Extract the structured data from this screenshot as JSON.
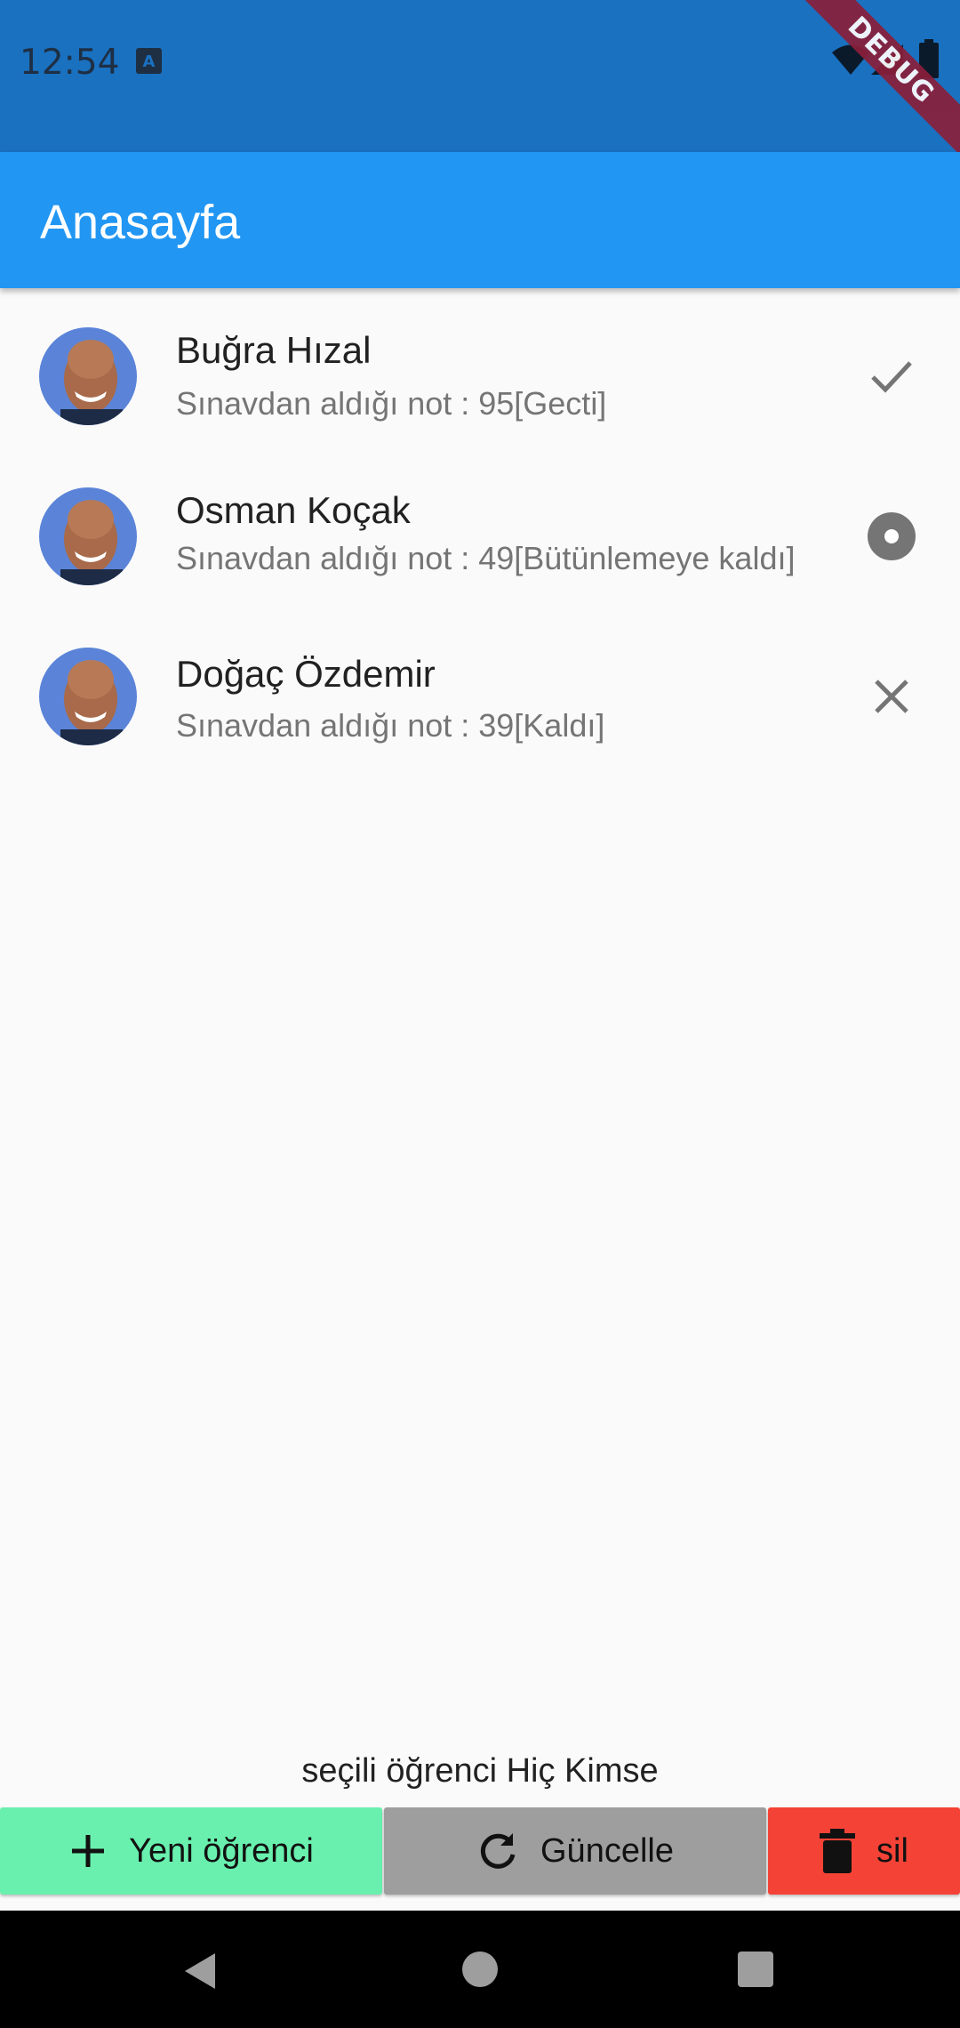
{
  "status_bar": {
    "time": "12:54",
    "icons": [
      "a-icon",
      "wifi-icon",
      "signal-icon",
      "battery-icon"
    ],
    "debug_label": "DEBUG",
    "background": "#1a71c0"
  },
  "app_bar": {
    "title": "Anasayfa",
    "background": "#2196f3"
  },
  "students": [
    {
      "name": "Buğra Hızal",
      "subtitle": "Sınavdan aldığı not : 95[Gecti]",
      "status_icon": "check-icon"
    },
    {
      "name": "Osman Koçak",
      "subtitle": "Sınavdan aldığı not : 49[Bütünlemeye kaldı]",
      "status_icon": "radio-icon"
    },
    {
      "name": "Doğaç Özdemir",
      "subtitle": "Sınavdan aldığı not : 39[Kaldı]",
      "status_icon": "close-icon"
    }
  ],
  "selected_text": "seçili öğrenci Hiç  Kimse",
  "buttons": {
    "new_label": "Yeni öğrenci",
    "update_label": "Güncelle",
    "delete_label": "sil",
    "new_color": "#69f0ae",
    "update_color": "#9e9e9e",
    "delete_color": "#f44336"
  },
  "nav_bar": {
    "icons": [
      "back-icon",
      "home-icon",
      "recents-icon"
    ]
  }
}
